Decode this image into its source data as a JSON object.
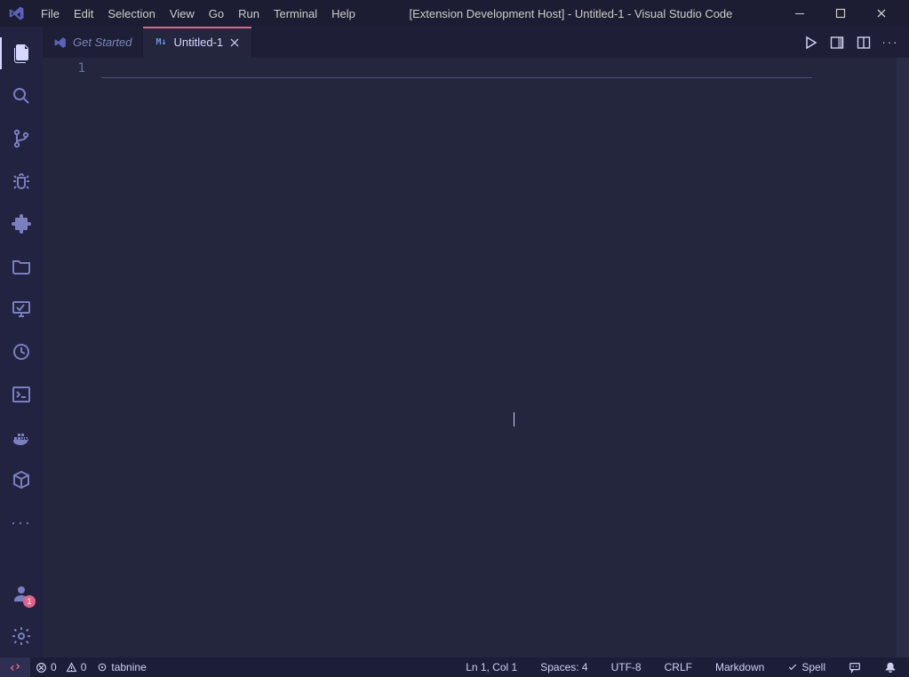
{
  "window": {
    "title": "[Extension Development Host] - Untitled-1 - Visual Studio Code"
  },
  "menu": [
    "File",
    "Edit",
    "Selection",
    "View",
    "Go",
    "Run",
    "Terminal",
    "Help"
  ],
  "activity": {
    "account_badge": "1"
  },
  "tabs": {
    "getStarted": {
      "label": "Get Started"
    },
    "untitled": {
      "label": "Untitled-1",
      "iconText": "M↓"
    }
  },
  "editor": {
    "lineNumber1": "1"
  },
  "status": {
    "errors": "0",
    "warnings": "0",
    "tabnine": "tabnine",
    "cursor": "Ln 1, Col 1",
    "spaces": "Spaces: 4",
    "encoding": "UTF-8",
    "eol": "CRLF",
    "language": "Markdown",
    "spell": "Spell"
  }
}
